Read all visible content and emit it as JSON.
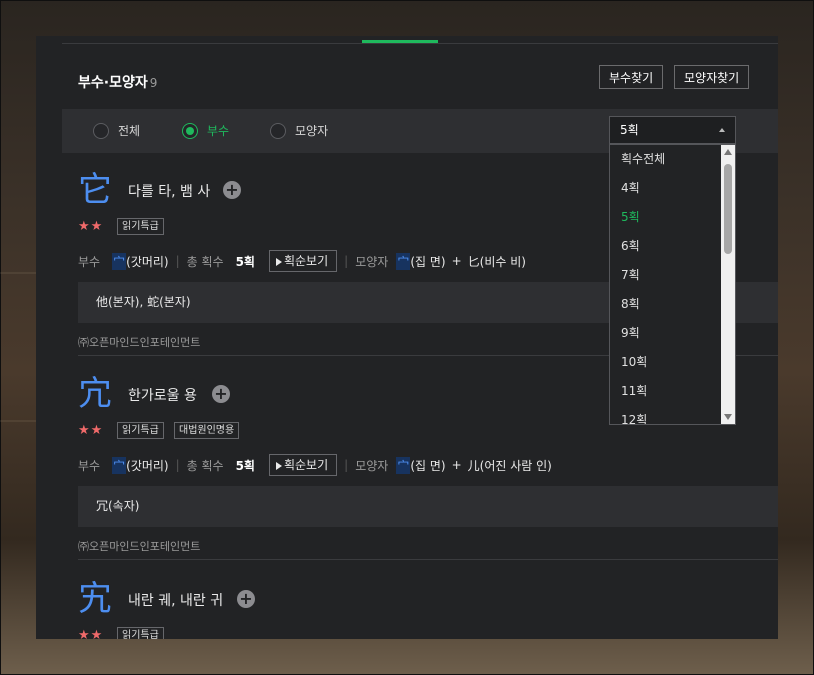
{
  "section": {
    "title": "부수·모양자",
    "count": "9"
  },
  "buttons": {
    "find_radical": "부수찾기",
    "find_shape": "모양자찾기"
  },
  "filters": [
    {
      "label": "전체",
      "selected": false
    },
    {
      "label": "부수",
      "selected": true
    },
    {
      "label": "모양자",
      "selected": false
    }
  ],
  "stroke_select": {
    "value": "5획",
    "options": [
      "획수전체",
      "4획",
      "5획",
      "6획",
      "7획",
      "8획",
      "9획",
      "10획",
      "11획",
      "12획"
    ],
    "selected_index": 2
  },
  "labels": {
    "radical": "부수",
    "total_strokes": "총 획수",
    "stroke_order": "획순보기",
    "shape": "모양자"
  },
  "entries": [
    {
      "hanja": "它",
      "meaning": "다를 타, 뱀 사",
      "stars": "★★",
      "badges": [
        "읽기특급"
      ],
      "radical_char": "宀",
      "radical_name": "(갓머리)",
      "strokes": "5획",
      "shape_part1_char": "宀",
      "shape_part1_name": "(집 면)",
      "plus": "+",
      "shape_part2": "匕(비수 비)",
      "variants": "他(본자), 蛇(본자)",
      "source": "㈜오픈마인드인포테인먼트"
    },
    {
      "hanja": "宂",
      "meaning": "한가로울 용",
      "stars": "★★",
      "badges": [
        "읽기특급",
        "대법원인명용"
      ],
      "radical_char": "宀",
      "radical_name": "(갓머리)",
      "strokes": "5획",
      "shape_part1_char": "宀",
      "shape_part1_name": "(집 면)",
      "plus": "+",
      "shape_part2": "儿(어진 사람 인)",
      "variants": "冗(속자)",
      "source": "㈜오픈마인드인포테인먼트"
    },
    {
      "hanja": "宄",
      "meaning": "내란 궤, 내란 귀",
      "stars": "★★",
      "badges": [
        "읽기특급"
      ]
    }
  ],
  "colors": {
    "accent": "#1fb95d",
    "hanja": "#4d8ef0",
    "star": "#f06a6a",
    "panel": "#222325"
  }
}
